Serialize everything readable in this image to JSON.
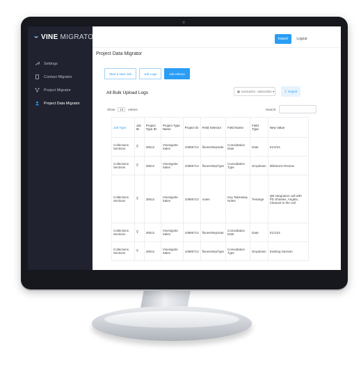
{
  "brand": {
    "name_bold": "VINE",
    "name_light": "MIGRATOR"
  },
  "sidebar": {
    "items": [
      {
        "label": "Settings",
        "icon": "wrench-icon"
      },
      {
        "label": "Contact Migrator",
        "icon": "document-icon"
      },
      {
        "label": "Project Migrator",
        "icon": "network-icon"
      },
      {
        "label": "Project Data Migrator",
        "icon": "user-icon",
        "active": true
      }
    ]
  },
  "topbar": {
    "import_label": "Import",
    "logout_label": "Logout"
  },
  "page": {
    "title": "Project Data Migrator",
    "tabs": [
      {
        "label": "Start a New Job",
        "active": false
      },
      {
        "label": "Job Logs",
        "active": false
      },
      {
        "label": "Job History",
        "active": true
      }
    ],
    "section_title": "All Bulk Upload Logs",
    "date_range": "01/01/2023 - 08/31/2023",
    "export_label": "Export",
    "show_label": "Show",
    "entries_value": "10",
    "entries_label": "entries",
    "search_label": "Search:"
  },
  "table": {
    "columns": [
      "Job Type",
      "Job ID",
      "Project Type ID",
      "Project Type Name",
      "Project ID",
      "Field Selector",
      "Field Name",
      "Field Type",
      "New Value"
    ],
    "rows": [
      [
        "Collections Sections",
        "",
        "28512",
        "Vinesignite Sales",
        "10985713",
        "fluneeStepSate",
        "Consultation Date",
        "Date",
        "01/1/24"
      ],
      [
        "Collections Sections",
        "",
        "28512",
        "Vinesignite Sales",
        "10985713",
        "fluneeStepType",
        "Consultation Type",
        "Dropdown",
        "Milestone Review"
      ],
      [
        "Collections Sections",
        "",
        "28512",
        "Vinesignite Sales",
        "10985713",
        "notes",
        "Key Takeaway Notes",
        "Textarge",
        "QB integration call with PD Shaeles, Angela, Cleaned in the call"
      ],
      [
        "Collections Sections",
        "",
        "28512",
        "Vinesignite Sales",
        "10985713",
        "fluneeStepSate",
        "Consultation Date",
        "Date",
        "01/1/24"
      ],
      [
        "Collections Sections",
        "",
        "28512",
        "Vinesignite Sales",
        "10985713",
        "fluneeStepType",
        "Consultation Type",
        "Dropdown",
        "Existing Session"
      ]
    ]
  },
  "colors": {
    "sidebar_bg": "#20222f",
    "accent": "#2a9df4"
  }
}
